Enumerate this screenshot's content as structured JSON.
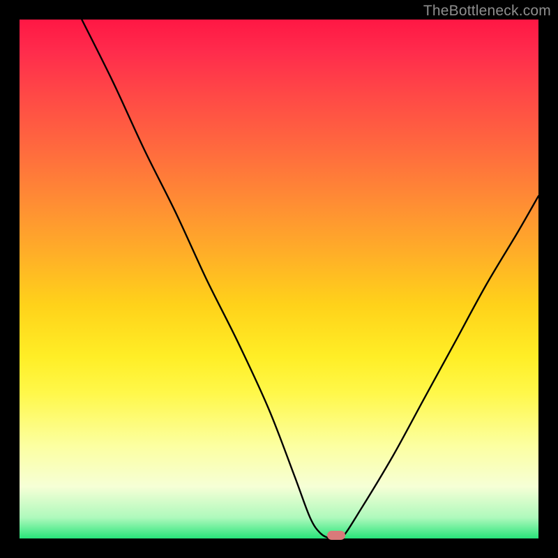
{
  "watermark": "TheBottleneck.com",
  "colors": {
    "page_bg": "#000000",
    "curve_stroke": "#000000",
    "marker_fill": "#d97a7a",
    "gradient_top": "#ff1744",
    "gradient_bottom": "#28e57a"
  },
  "chart_data": {
    "type": "line",
    "title": "",
    "xlabel": "",
    "ylabel": "",
    "xlim": [
      0,
      100
    ],
    "ylim": [
      0,
      100
    ],
    "grid": false,
    "legend": false,
    "series": [
      {
        "name": "bottleneck-curve",
        "x": [
          12,
          18,
          24,
          30,
          36,
          42,
          48,
          53,
          56,
          58,
          60,
          62,
          66,
          72,
          78,
          84,
          90,
          96,
          100
        ],
        "values": [
          100,
          88,
          75,
          63,
          50,
          38,
          25,
          12,
          4,
          1,
          0,
          0,
          6,
          16,
          27,
          38,
          49,
          59,
          66
        ]
      }
    ],
    "annotations": [
      {
        "name": "optimal-marker",
        "x": 61,
        "y": 0
      }
    ]
  }
}
